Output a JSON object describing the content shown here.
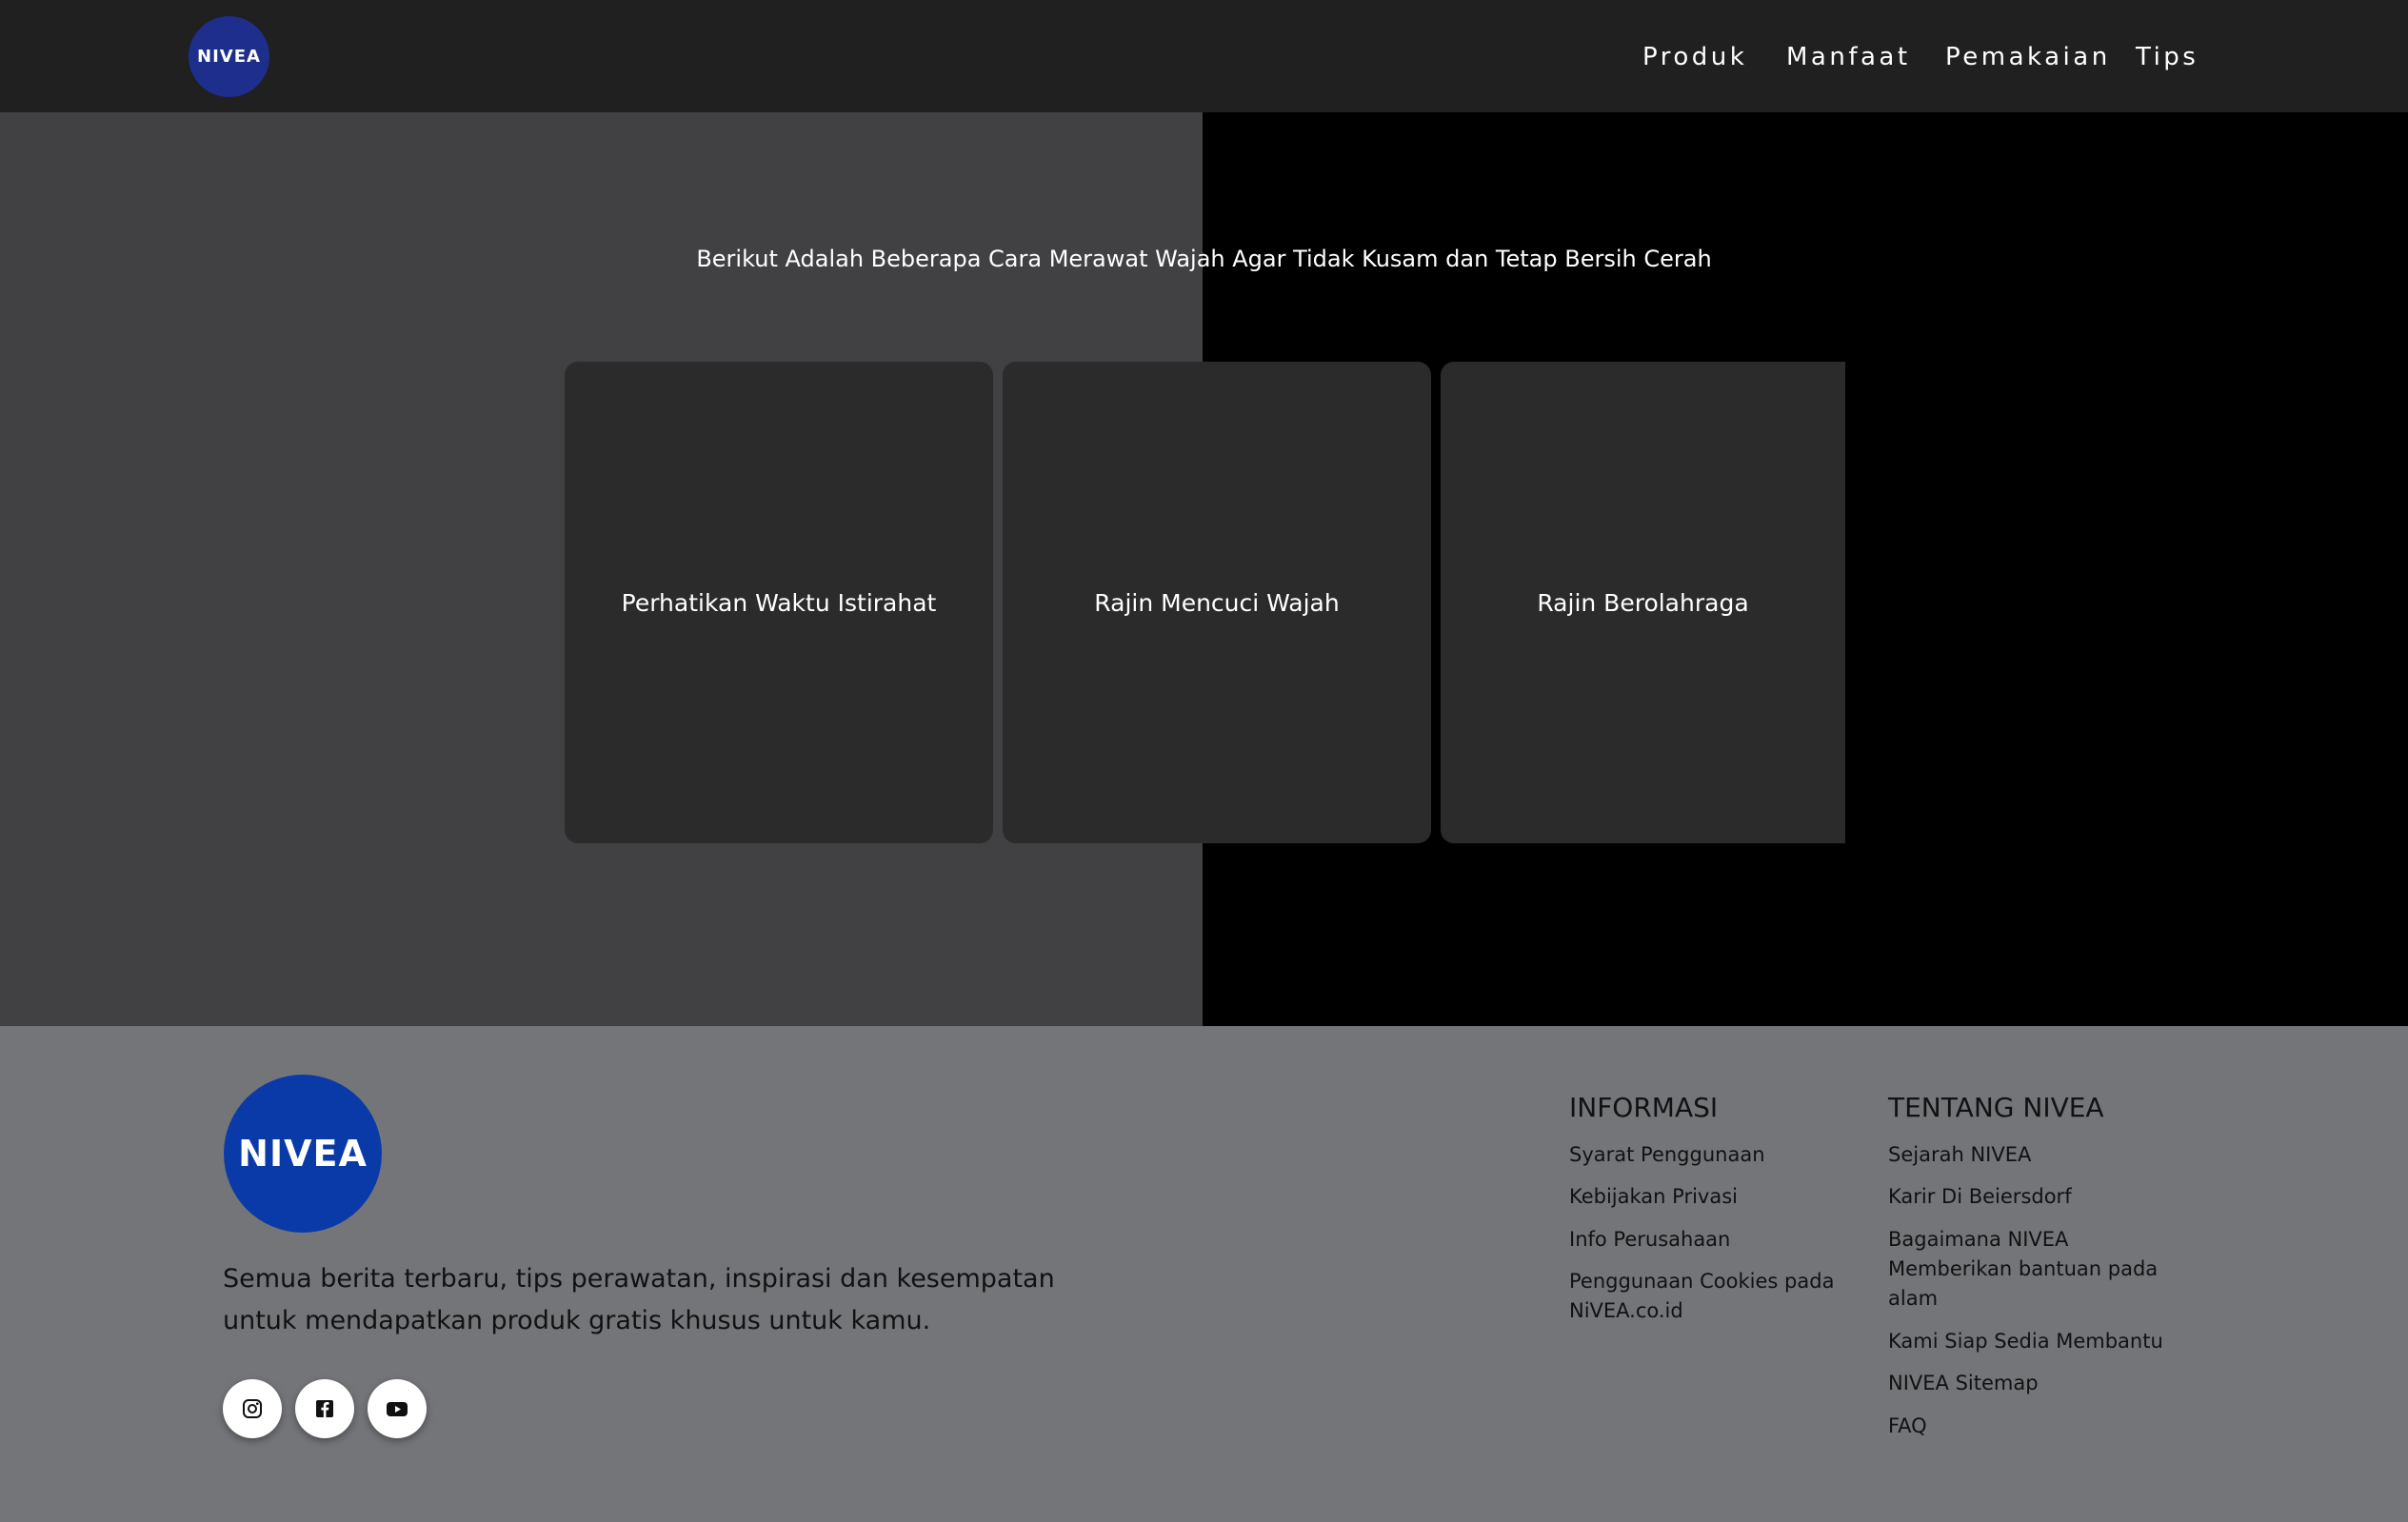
{
  "header": {
    "logo_text": "NIVEA",
    "nav": [
      {
        "label": "Produk"
      },
      {
        "label": "Manfaat"
      },
      {
        "label": "Pemakaian"
      },
      {
        "label": "Tips"
      }
    ]
  },
  "hero": {
    "title": "Berikut Adalah Beberapa Cara Merawat Wajah Agar Tidak Kusam dan Tetap Bersih Cerah",
    "cards": [
      {
        "label": "Perhatikan Waktu Istirahat"
      },
      {
        "label": "Rajin Mencuci Wajah"
      },
      {
        "label": "Rajin Berolahraga"
      }
    ]
  },
  "footer": {
    "logo_text": "NIVEA",
    "tagline": "Semua berita terbaru, tips perawatan, inspirasi dan kesempatan untuk mendapatkan produk gratis khusus untuk kamu.",
    "social": [
      {
        "icon": "instagram-icon"
      },
      {
        "icon": "facebook-icon"
      },
      {
        "icon": "youtube-icon"
      }
    ],
    "informasi": {
      "heading": "INFORMASI",
      "links": [
        "Syarat Penggunaan",
        "Kebijakan Privasi",
        "Info Perusahaan",
        "Penggunaan Cookies pada NiVEA.co.id"
      ]
    },
    "tentang": {
      "heading": "TENTANG NIVEA",
      "links": [
        "Sejarah NIVEA",
        "Karir Di Beiersdorf",
        "Bagaimana NIVEA Memberikan bantuan pada alam",
        "Kami Siap Sedia Membantu",
        "NIVEA Sitemap",
        "FAQ"
      ]
    }
  },
  "colors": {
    "header_bg": "#202021",
    "hero_left_bg": "#414043",
    "hero_right_bg": "#000000",
    "card_bg": "#2b2b2c",
    "footer_bg": "#737579",
    "nivea_blue": "#0a3aa8"
  }
}
